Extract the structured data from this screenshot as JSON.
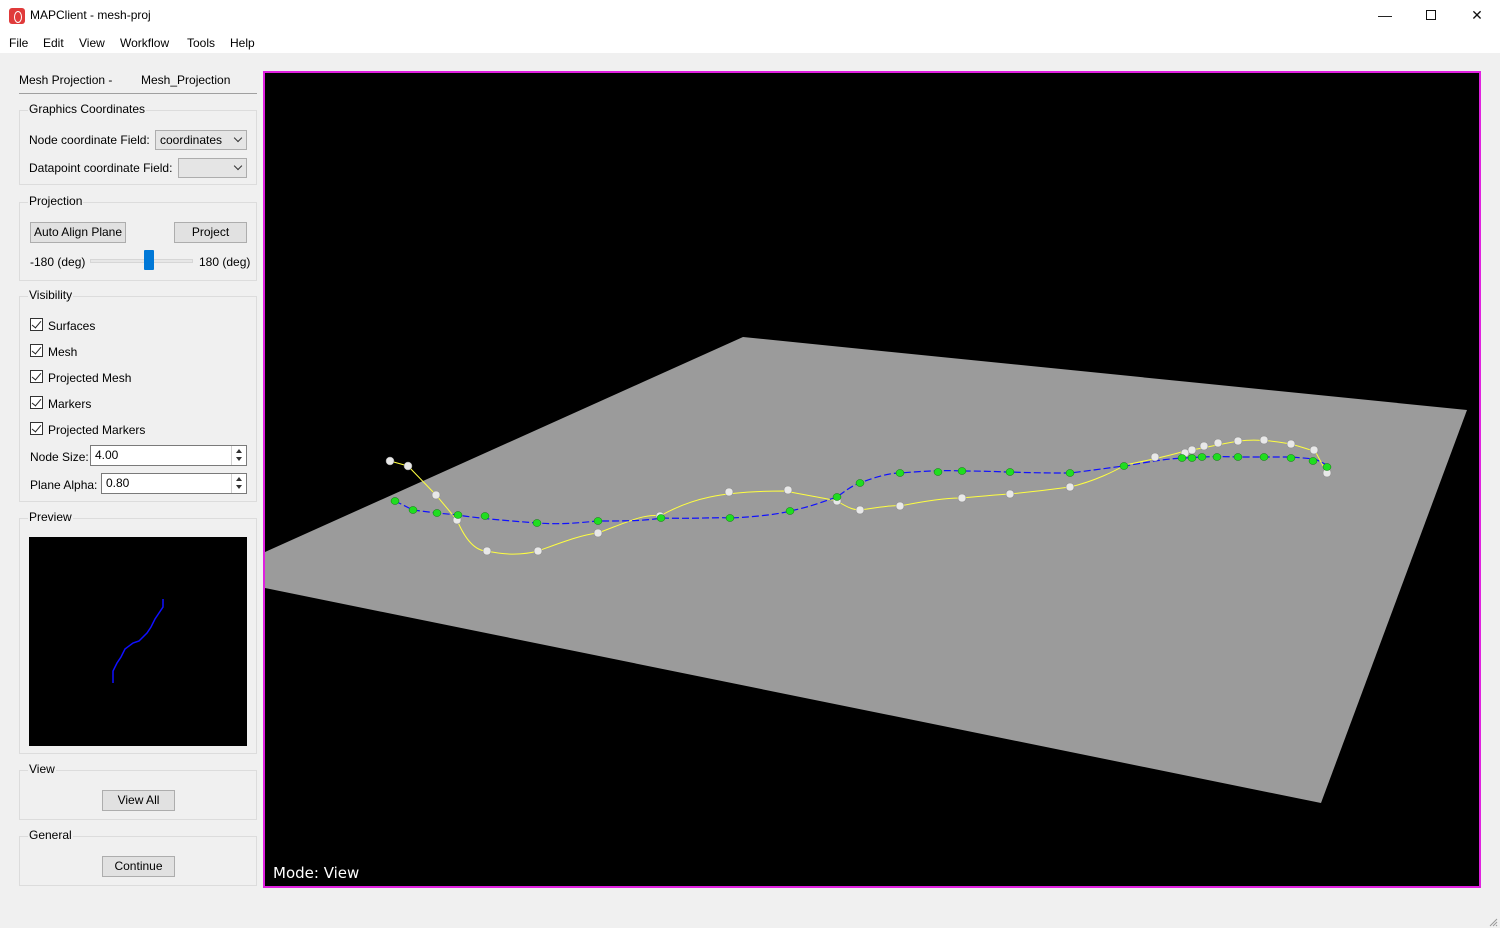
{
  "window": {
    "title": "MAPClient - mesh-proj"
  },
  "menu": [
    "File",
    "Edit",
    "View",
    "Workflow",
    "Tools",
    "Help"
  ],
  "step": {
    "type": "Mesh Projection -",
    "name": "Mesh_Projection"
  },
  "graphics_coordinates": {
    "title": "Graphics Coordinates",
    "node_label": "Node coordinate Field:",
    "node_value": "coordinates",
    "datapoint_label": "Datapoint coordinate Field:",
    "datapoint_value": ""
  },
  "projection": {
    "title": "Projection",
    "auto_align_label": "Auto Align Plane",
    "project_label": "Project",
    "min_label": "-180 (deg)",
    "max_label": "180 (deg)",
    "slider_fraction": 0.5
  },
  "visibility": {
    "title": "Visibility",
    "items": [
      {
        "label": "Surfaces",
        "checked": true
      },
      {
        "label": "Mesh",
        "checked": true
      },
      {
        "label": "Projected Mesh",
        "checked": true
      },
      {
        "label": "Markers",
        "checked": true
      },
      {
        "label": "Projected Markers",
        "checked": true
      }
    ],
    "node_size_label": "Node Size:",
    "node_size_value": "4.00",
    "plane_alpha_label": "Plane Alpha:",
    "plane_alpha_value": "0.80"
  },
  "preview": {
    "title": "Preview"
  },
  "view": {
    "title": "View",
    "view_all_label": "View All"
  },
  "general": {
    "title": "General",
    "continue_label": "Continue"
  },
  "viewport": {
    "mode_label": "Mode: View"
  },
  "colors": {
    "plane": "#9b9b9b",
    "projected_curve": "#1010ff",
    "mesh_curve": "#ffff40",
    "projected_node": "#20dd20",
    "mesh_node": "#e8e8e8",
    "viewport_border": "#e020e0"
  }
}
